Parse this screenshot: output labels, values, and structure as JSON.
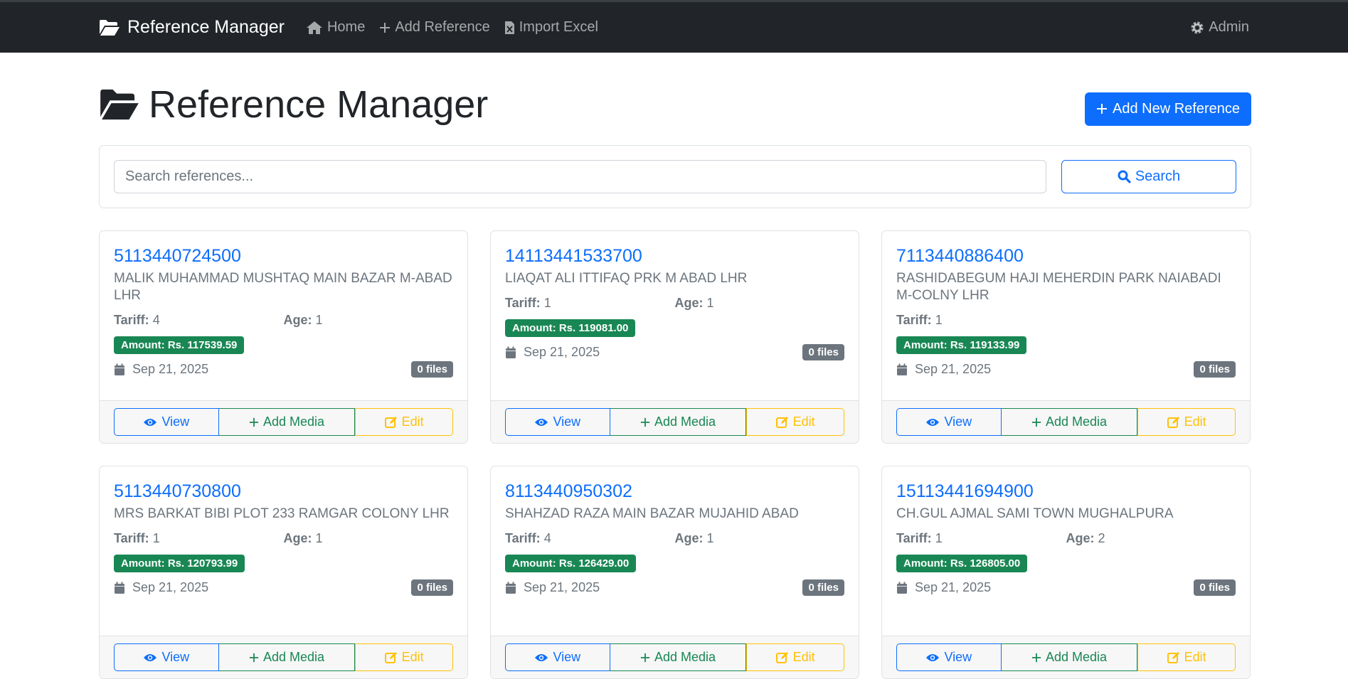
{
  "nav": {
    "brand": "Reference Manager",
    "home": "Home",
    "add_reference": "Add Reference",
    "import_excel": "Import Excel",
    "admin": "Admin"
  },
  "page": {
    "title": "Reference Manager",
    "add_new_button": "Add New Reference"
  },
  "search": {
    "placeholder": "Search references...",
    "button": "Search"
  },
  "labels": {
    "tariff": "Tariff:",
    "age": "Age:",
    "view": "View",
    "add_media": "Add Media",
    "edit": "Edit"
  },
  "cards": [
    {
      "ref": "5113440724500",
      "name": "MALIK MUHAMMAD MUSHTAQ MAIN BAZAR M-ABAD LHR",
      "tariff": "4",
      "age": "1",
      "amount": "Amount: Rs. 117539.59",
      "date": "Sep 21, 2025",
      "files": "0 files"
    },
    {
      "ref": "14113441533700",
      "name": "LIAQAT ALI ITTIFAQ PRK M ABAD LHR",
      "tariff": "1",
      "age": "1",
      "amount": "Amount: Rs. 119081.00",
      "date": "Sep 21, 2025",
      "files": "0 files"
    },
    {
      "ref": "7113440886400",
      "name": "RASHIDABEGUM HAJI MEHERDIN PARK NAIABADI M-COLNY LHR",
      "tariff": "1",
      "age": "",
      "amount": "Amount: Rs. 119133.99",
      "date": "Sep 21, 2025",
      "files": "0 files"
    },
    {
      "ref": "5113440730800",
      "name": "MRS BARKAT BIBI PLOT 233 RAMGAR COLONY LHR",
      "tariff": "1",
      "age": "1",
      "amount": "Amount: Rs. 120793.99",
      "date": "Sep 21, 2025",
      "files": "0 files"
    },
    {
      "ref": "8113440950302",
      "name": "SHAHZAD RAZA MAIN BAZAR MUJAHID ABAD",
      "tariff": "4",
      "age": "1",
      "amount": "Amount: Rs. 126429.00",
      "date": "Sep 21, 2025",
      "files": "0 files"
    },
    {
      "ref": "15113441694900",
      "name": "CH.GUL AJMAL SAMI TOWN MUGHALPURA",
      "tariff": "1",
      "age": "2",
      "amount": "Amount: Rs. 126805.00",
      "date": "Sep 21, 2025",
      "files": "0 files"
    }
  ],
  "colors": {
    "primary": "#0d6efd",
    "success": "#198754",
    "warning": "#ffc107",
    "secondary": "#6c757d",
    "navbar": "#212529"
  }
}
